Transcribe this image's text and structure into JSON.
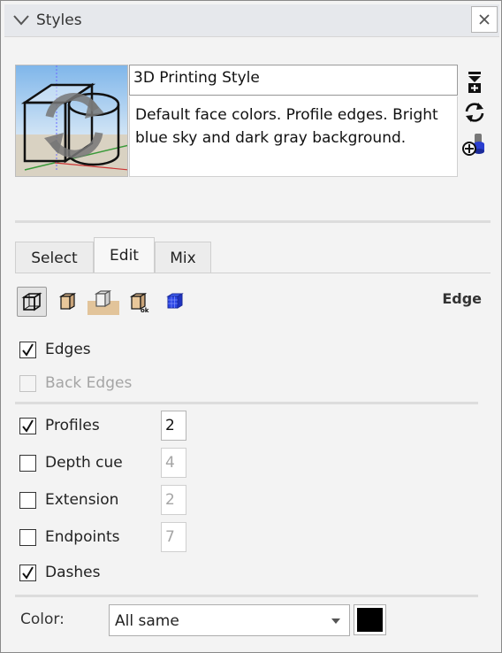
{
  "panel": {
    "title": "Styles",
    "close_label": "×"
  },
  "style": {
    "name": "3D Printing Style",
    "description": "Default face colors. Profile edges. Bright blue sky and dark gray background."
  },
  "tabs": [
    {
      "label": "Select",
      "active": false
    },
    {
      "label": "Edit",
      "active": true
    },
    {
      "label": "Mix",
      "active": false
    }
  ],
  "toolbar": {
    "section_label": "Edge"
  },
  "options": {
    "edges": {
      "label": "Edges",
      "checked": true
    },
    "back_edges": {
      "label": "Back Edges",
      "checked": false,
      "disabled": true
    },
    "profiles": {
      "label": "Profiles",
      "checked": true,
      "value": "2"
    },
    "depth_cue": {
      "label": "Depth cue",
      "checked": false,
      "value": "4"
    },
    "extension": {
      "label": "Extension",
      "checked": false,
      "value": "2"
    },
    "endpoints": {
      "label": "Endpoints",
      "checked": false,
      "value": "7"
    },
    "dashes": {
      "label": "Dashes",
      "checked": true
    }
  },
  "color": {
    "label": "Color:",
    "selected": "All same",
    "swatch": "#000000"
  },
  "colors": {
    "header_bg": "#e6e8ec",
    "panel_bg": "#f3f3f3",
    "accent_blue": "#1f3fd6",
    "tan": "#e8c79a"
  }
}
